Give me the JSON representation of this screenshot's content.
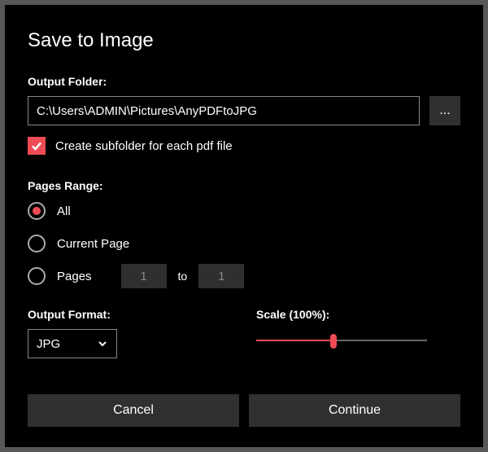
{
  "title": "Save to Image",
  "output_folder": {
    "label": "Output Folder:",
    "path": "C:\\Users\\ADMIN\\Pictures\\AnyPDFtoJPG",
    "browse_label": "..."
  },
  "subfolder": {
    "checked": true,
    "label": "Create subfolder for each pdf file"
  },
  "pages_range": {
    "label": "Pages Range:",
    "options": {
      "all": "All",
      "current": "Current Page",
      "pages": "Pages"
    },
    "selected": "all",
    "from": "1",
    "to_label": "to",
    "to": "1"
  },
  "output_format": {
    "label": "Output Format:",
    "value": "JPG"
  },
  "scale": {
    "label": "Scale (100%):",
    "percent": 45
  },
  "buttons": {
    "cancel": "Cancel",
    "continue": "Continue"
  },
  "colors": {
    "accent": "#ef4b55"
  }
}
